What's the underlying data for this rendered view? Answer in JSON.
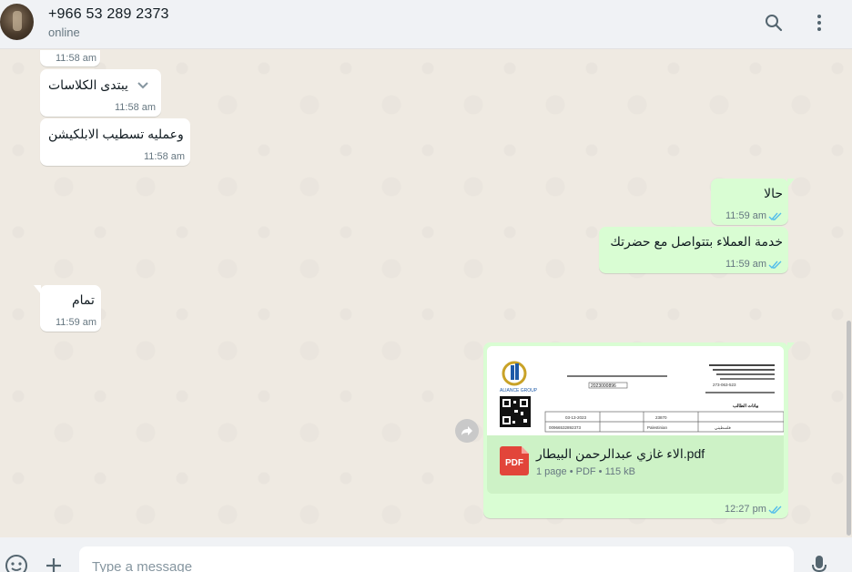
{
  "header": {
    "contact_name": "+966 53 289 2373",
    "status": "online",
    "search_icon": "search-icon",
    "menu_icon": "kebab-menu-icon"
  },
  "messages": [
    {
      "dir": "in",
      "text": "",
      "time": "11:58 am"
    },
    {
      "dir": "in",
      "text": "يبتدى الكلاسات",
      "time": "11:58 am",
      "chevron_icon": "chevron-down-icon"
    },
    {
      "dir": "in",
      "text": "وعمليه تسطيب الابلكيشن",
      "time": "11:58 am"
    },
    {
      "dir": "out",
      "text": "حالا",
      "time": "11:59 am",
      "status": "read"
    },
    {
      "dir": "out",
      "text": "خدمة العملاء بتتواصل مع حضرتك",
      "time": "11:59 am",
      "status": "read"
    },
    {
      "dir": "in",
      "text": "تمام",
      "time": "11:59 am"
    },
    {
      "dir": "out",
      "type": "document",
      "file_name": "الاء غازي عبدالرحمن البيطار.pdf",
      "file_info": "1 page • PDF • 115 kB",
      "file_badge": "PDF",
      "time": "12:27 pm",
      "status": "read",
      "preview": {
        "logo_text": "ALIANCE GROUP",
        "invoice_no": "2023000896",
        "student_label": "بيانات الطالب",
        "phone": "273-063-523",
        "date": "03-13-2023",
        "student_no": "23870",
        "nationality": "فلسطيني",
        "nationality_en": "Palestinian",
        "mobile": "00966532892373"
      }
    }
  ],
  "footer": {
    "placeholder": "Type a message",
    "emoji_icon": "emoji-icon",
    "attach_icon": "plus-icon",
    "mic_icon": "mic-icon"
  },
  "colors": {
    "chat_bg": "#efeae2",
    "incoming": "#ffffff",
    "outgoing": "#d9fdd3",
    "read_tick": "#53bdeb",
    "pdf_red": "#e2453a"
  }
}
